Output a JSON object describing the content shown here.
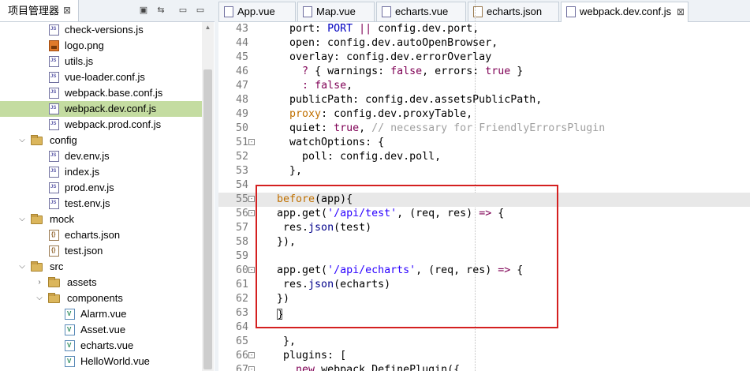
{
  "explorer": {
    "title": "项目管理器",
    "close_label": "⊠",
    "tools": [
      "▣",
      "⇆",
      "▭",
      "▭"
    ],
    "items": [
      {
        "label": "check-versions.js",
        "kind": "file",
        "depth": 3
      },
      {
        "label": "logo.png",
        "kind": "image",
        "depth": 3
      },
      {
        "label": "utils.js",
        "kind": "file",
        "depth": 3
      },
      {
        "label": "vue-loader.conf.js",
        "kind": "file",
        "depth": 3
      },
      {
        "label": "webpack.base.conf.js",
        "kind": "file",
        "depth": 3
      },
      {
        "label": "webpack.dev.conf.js",
        "kind": "file",
        "depth": 3,
        "selected": true
      },
      {
        "label": "webpack.prod.conf.js",
        "kind": "file",
        "depth": 3
      },
      {
        "label": "config",
        "kind": "folder",
        "depth": 2,
        "expanded": true
      },
      {
        "label": "dev.env.js",
        "kind": "file",
        "depth": 3
      },
      {
        "label": "index.js",
        "kind": "file",
        "depth": 3
      },
      {
        "label": "prod.env.js",
        "kind": "file",
        "depth": 3
      },
      {
        "label": "test.env.js",
        "kind": "file",
        "depth": 3
      },
      {
        "label": "mock",
        "kind": "folder",
        "depth": 2,
        "expanded": true
      },
      {
        "label": "echarts.json",
        "kind": "json",
        "depth": 3
      },
      {
        "label": "test.json",
        "kind": "json",
        "depth": 3
      },
      {
        "label": "src",
        "kind": "folder",
        "depth": 2,
        "expanded": true
      },
      {
        "label": "assets",
        "kind": "folder",
        "depth": 3,
        "expanded": false
      },
      {
        "label": "components",
        "kind": "folder",
        "depth": 3,
        "expanded": true
      },
      {
        "label": "Alarm.vue",
        "kind": "vue",
        "depth": 4
      },
      {
        "label": "Asset.vue",
        "kind": "vue",
        "depth": 4
      },
      {
        "label": "echarts.vue",
        "kind": "vue",
        "depth": 4
      },
      {
        "label": "HelloWorld.vue",
        "kind": "vue",
        "depth": 4
      }
    ]
  },
  "editor": {
    "tabs": [
      {
        "label": "App.vue",
        "icon": "vue-file-icon",
        "active": false
      },
      {
        "label": "Map.vue",
        "icon": "vue-file-icon",
        "active": false
      },
      {
        "label": "echarts.vue",
        "icon": "vue-file-icon",
        "active": false
      },
      {
        "label": "echarts.json",
        "icon": "json-file-icon",
        "active": false
      },
      {
        "label": "webpack.dev.conf.js",
        "icon": "js-file-icon",
        "active": true
      }
    ],
    "tab_close_label": "⊠",
    "lines": [
      {
        "n": "43",
        "fold": "",
        "cur": false,
        "parts": [
          [
            "r",
            "    port: "
          ],
          [
            "b",
            "PORT"
          ],
          [
            "r",
            " "
          ],
          [
            "k",
            "||"
          ],
          [
            "r",
            " config.dev.port,"
          ]
        ]
      },
      {
        "n": "44",
        "fold": "",
        "cur": false,
        "parts": [
          [
            "r",
            "    open: config.dev.autoOpenBrowser,"
          ]
        ]
      },
      {
        "n": "45",
        "fold": "",
        "cur": false,
        "parts": [
          [
            "r",
            "    overlay: config.dev.errorOverlay"
          ]
        ]
      },
      {
        "n": "46",
        "fold": "",
        "cur": false,
        "parts": [
          [
            "r",
            "      "
          ],
          [
            "k",
            "?"
          ],
          [
            "r",
            " { warnings: "
          ],
          [
            "kw",
            "false"
          ],
          [
            "r",
            ", errors: "
          ],
          [
            "kw",
            "true"
          ],
          [
            "r",
            " }"
          ]
        ]
      },
      {
        "n": "47",
        "fold": "",
        "cur": false,
        "parts": [
          [
            "r",
            "      "
          ],
          [
            "k",
            ":"
          ],
          [
            "r",
            " "
          ],
          [
            "kw",
            "false"
          ],
          [
            "r",
            ","
          ]
        ]
      },
      {
        "n": "48",
        "fold": "",
        "cur": false,
        "parts": [
          [
            "r",
            "    publicPath: config.dev.assetsPublicPath,"
          ]
        ]
      },
      {
        "n": "49",
        "fold": "",
        "cur": false,
        "parts": [
          [
            "o",
            "    proxy"
          ],
          [
            "r",
            ": config.dev.proxyTable,"
          ]
        ]
      },
      {
        "n": "50",
        "fold": "",
        "cur": false,
        "parts": [
          [
            "r",
            "    quiet: "
          ],
          [
            "kw",
            "true"
          ],
          [
            "r",
            ", "
          ],
          [
            "c",
            "// necessary for FriendlyErrorsPlugin"
          ]
        ]
      },
      {
        "n": "51",
        "fold": "-",
        "cur": false,
        "parts": [
          [
            "r",
            "    watchOptions: {"
          ]
        ]
      },
      {
        "n": "52",
        "fold": "",
        "cur": false,
        "parts": [
          [
            "r",
            "      poll: config.dev.poll,"
          ]
        ]
      },
      {
        "n": "53",
        "fold": "",
        "cur": false,
        "parts": [
          [
            "r",
            "    },"
          ]
        ]
      },
      {
        "n": "54",
        "fold": "",
        "cur": false,
        "parts": [
          [
            "r",
            ""
          ]
        ]
      },
      {
        "n": "55",
        "fold": "-",
        "cur": true,
        "parts": [
          [
            "o",
            "  before"
          ],
          [
            "r",
            "(app){"
          ]
        ]
      },
      {
        "n": "56",
        "fold": "-",
        "cur": false,
        "parts": [
          [
            "r",
            "  app.get("
          ],
          [
            "s",
            "'/api/test'"
          ],
          [
            "r",
            ", (req, res) "
          ],
          [
            "k",
            "=>"
          ],
          [
            "r",
            " {"
          ]
        ]
      },
      {
        "n": "57",
        "fold": "",
        "cur": false,
        "parts": [
          [
            "r",
            "   res."
          ],
          [
            "fn",
            "json"
          ],
          [
            "r",
            "(test)"
          ]
        ]
      },
      {
        "n": "58",
        "fold": "",
        "cur": false,
        "parts": [
          [
            "r",
            "  }),"
          ]
        ]
      },
      {
        "n": "59",
        "fold": "",
        "cur": false,
        "parts": [
          [
            "r",
            ""
          ]
        ]
      },
      {
        "n": "60",
        "fold": "-",
        "cur": false,
        "parts": [
          [
            "r",
            "  app.get("
          ],
          [
            "s",
            "'/api/echarts'"
          ],
          [
            "r",
            ", (req, res) "
          ],
          [
            "k",
            "=>"
          ],
          [
            "r",
            " {"
          ]
        ]
      },
      {
        "n": "61",
        "fold": "",
        "cur": false,
        "parts": [
          [
            "r",
            "   res."
          ],
          [
            "fn",
            "json"
          ],
          [
            "r",
            "(echarts)"
          ]
        ]
      },
      {
        "n": "62",
        "fold": "",
        "cur": false,
        "parts": [
          [
            "r",
            "  })"
          ]
        ]
      },
      {
        "n": "63",
        "fold": "",
        "cur": false,
        "parts": [
          [
            "r",
            "  }"
          ]
        ]
      },
      {
        "n": "64",
        "fold": "",
        "cur": false,
        "parts": [
          [
            "r",
            ""
          ]
        ]
      },
      {
        "n": "65",
        "fold": "",
        "cur": false,
        "parts": [
          [
            "r",
            "   },"
          ]
        ]
      },
      {
        "n": "66",
        "fold": "-",
        "cur": false,
        "parts": [
          [
            "r",
            "   plugins: ["
          ]
        ]
      },
      {
        "n": "67",
        "fold": "-",
        "cur": false,
        "parts": [
          [
            "r",
            "     "
          ],
          [
            "kw",
            "new"
          ],
          [
            "r",
            " webpack.DefinePlugin({"
          ]
        ]
      }
    ]
  },
  "colors": {
    "selection": "#c4dca1",
    "highlight_box": "#d42020",
    "keyword": "#7f0055",
    "string": "#2a00ff",
    "comment": "#a0a0a0"
  }
}
